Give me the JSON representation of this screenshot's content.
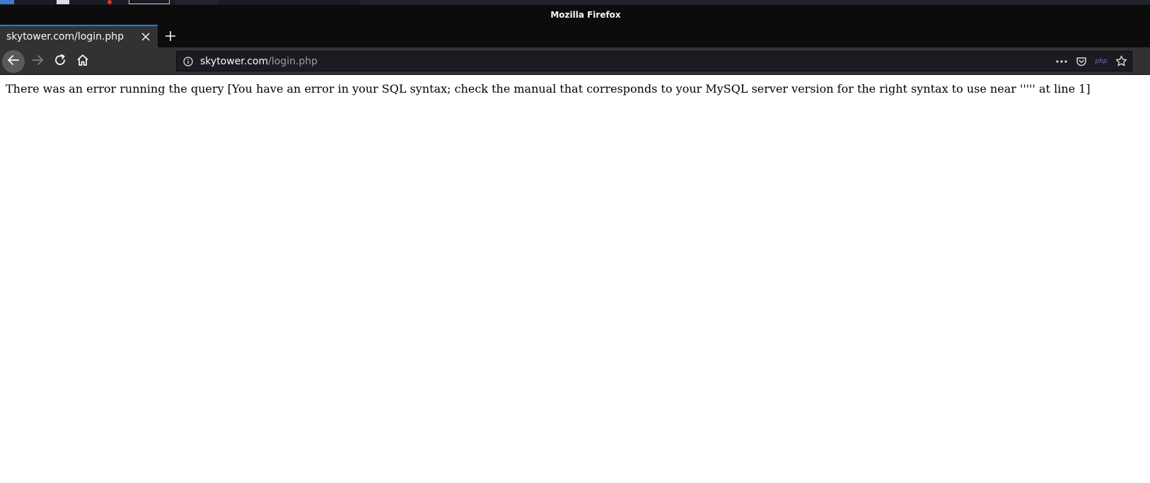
{
  "window": {
    "title": "Mozilla Firefox"
  },
  "tab": {
    "title": "skytower.com/login.php"
  },
  "urlbar": {
    "domain": "skytower.com",
    "path": "/login.php"
  },
  "pageactions": {
    "php_label": "php"
  },
  "page": {
    "message": "There was an error running the query [You have an error in your SQL syntax; check the manual that corresponds to your MySQL server version for the right syntax to use near ''''' at line 1]"
  },
  "icons": {
    "back": "back-arrow-icon",
    "forward": "forward-arrow-icon",
    "reload": "reload-icon",
    "home": "home-icon",
    "info": "info-icon",
    "more": "more-icon",
    "pocket": "pocket-icon",
    "bookmark": "star-icon",
    "close": "close-icon",
    "new_tab": "plus-icon"
  },
  "colors": {
    "accent": "#0a84ff",
    "toolbar": "#323234",
    "frame": "#0c0c0d"
  }
}
